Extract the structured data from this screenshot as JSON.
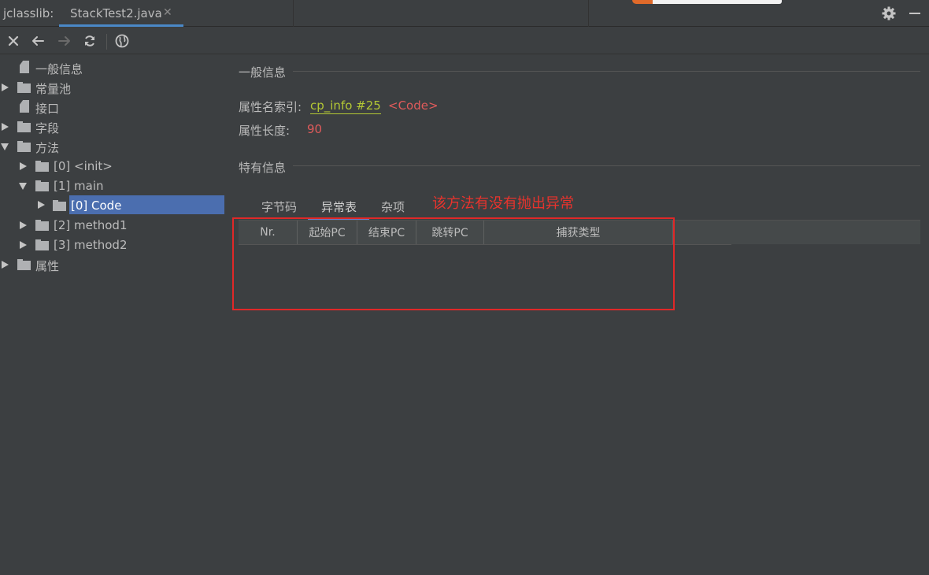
{
  "window": {
    "prefix": "jclasslib:",
    "tab_title": "StackTest2.java",
    "tab_close": "✕",
    "icons": [
      "settings-gear-icon",
      "minimize-icon"
    ]
  },
  "toolbar": {
    "buttons": [
      "close-icon",
      "back-arrow-icon",
      "forward-arrow-icon",
      "refresh-icon",
      "browser-globe-icon"
    ]
  },
  "tree": {
    "items": [
      {
        "label": "一般信息"
      },
      {
        "label": "常量池"
      },
      {
        "label": "接口"
      },
      {
        "label": "字段"
      },
      {
        "label": "方法"
      },
      {
        "label": "[0] <init>"
      },
      {
        "label": "[1] main"
      },
      {
        "label": "[0] Code"
      },
      {
        "label": "[2] method1"
      },
      {
        "label": "[3] method2"
      },
      {
        "label": "属性"
      }
    ]
  },
  "general": {
    "title": "一般信息",
    "attr_name_index_label": "属性名索引:",
    "attr_name_index_link": "cp_info #25",
    "attr_name_index_value": "<Code>",
    "attr_length_label": "属性长度:",
    "attr_length_value": "90"
  },
  "specific": {
    "title": "特有信息",
    "tabs": [
      "字节码",
      "异常表",
      "杂项"
    ],
    "active_tab": "异常表",
    "columns": [
      "Nr.",
      "起始PC",
      "结束PC",
      "跳转PC",
      "捕获类型"
    ]
  },
  "annotation": "该方法有没有抛出异常"
}
